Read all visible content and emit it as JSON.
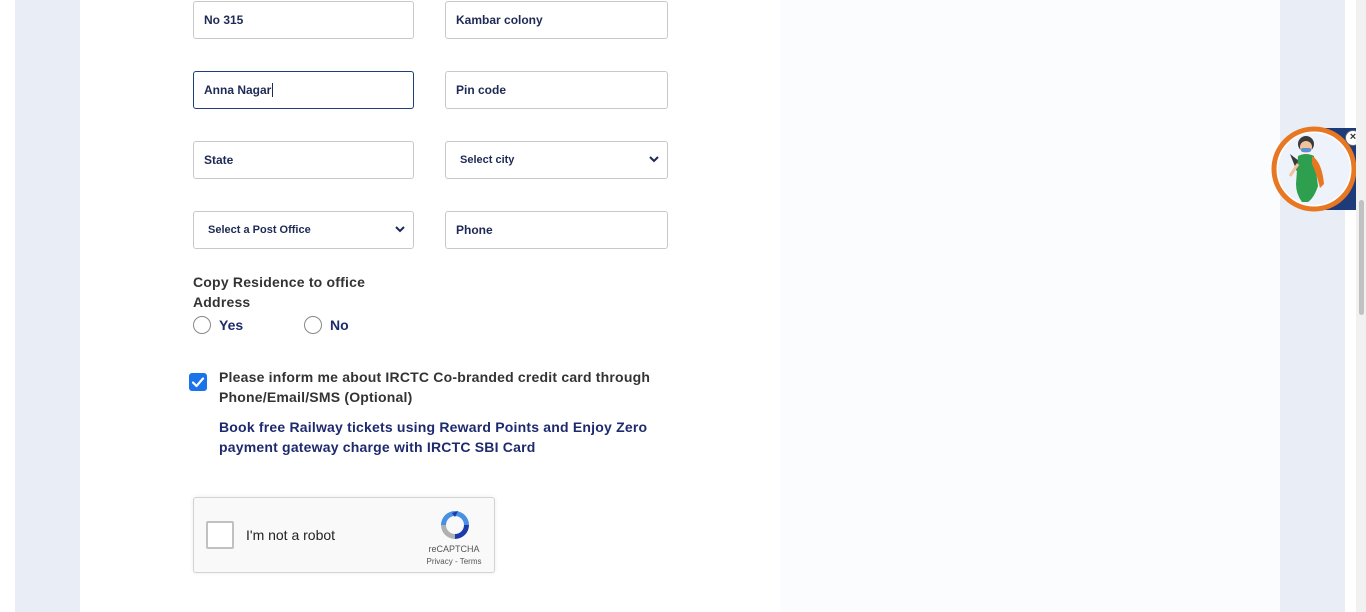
{
  "form": {
    "address_line1": {
      "value": "No 315"
    },
    "address_line2": {
      "value": "Kambar colony"
    },
    "address_line3": {
      "value": "Anna Nagar"
    },
    "pin_code": {
      "placeholder": "Pin code"
    },
    "state": {
      "placeholder": "State"
    },
    "city_select": {
      "selected": "Select city"
    },
    "post_office_select": {
      "selected": "Select a Post Office"
    },
    "phone": {
      "placeholder": "Phone"
    },
    "copy_residence": {
      "label": "Copy Residence to office Address",
      "options": [
        "Yes",
        "No"
      ]
    },
    "credit_card_opt_in": {
      "checked": true,
      "label": "Please inform me about IRCTC Co-branded credit card through Phone/Email/SMS (Optional)",
      "promo": "Book free Railway tickets using Reward Points and Enjoy Zero payment gateway charge with IRCTC SBI Card"
    }
  },
  "captcha": {
    "label": "I'm not a robot",
    "brand": "reCAPTCHA",
    "privacy": "Privacy",
    "separator": " - ",
    "terms": "Terms"
  },
  "icons": {
    "chevron": "chevron-down-icon",
    "check": "check-icon",
    "recaptcha": "recaptcha-logo-icon",
    "mascot": "assistant-mascot-icon",
    "close": "close-icon"
  },
  "colors": {
    "accent": "#1a73e8",
    "label_navy": "#1e2a6e",
    "page_bg": "#e8edf6"
  },
  "mascot": {
    "close_glyph": "×"
  }
}
